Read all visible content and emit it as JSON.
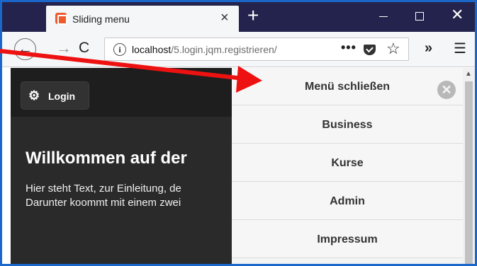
{
  "browser": {
    "tab_title": "Sliding menu",
    "tab_close": "×",
    "new_tab": "+",
    "win_close": "✕",
    "back": "←",
    "forward": "→",
    "reload": "C",
    "url_info": "i",
    "url_host": "localhost",
    "url_path": "/5.login.jqm.registrieren/",
    "url_more": "•••",
    "star": "☆",
    "overflow": "»",
    "menu": "☰"
  },
  "header": {
    "login_label": "Login",
    "gear": "⚙"
  },
  "content": {
    "heading": "Willkommen auf der",
    "line1": "Hier steht Text, zur Einleitung, de",
    "line2": "Darunter koommt mit einem zwei"
  },
  "panel": {
    "close_label": "Menü schließen",
    "close_glyph": "✕",
    "items": [
      {
        "label": "Business"
      },
      {
        "label": "Kurse"
      },
      {
        "label": "Admin"
      },
      {
        "label": "Impressum"
      }
    ]
  },
  "scrollbar": {
    "up": "▲"
  },
  "colors": {
    "titlebar": "#23234d",
    "arrow": "#ee1111",
    "frame": "#1a66c9"
  }
}
